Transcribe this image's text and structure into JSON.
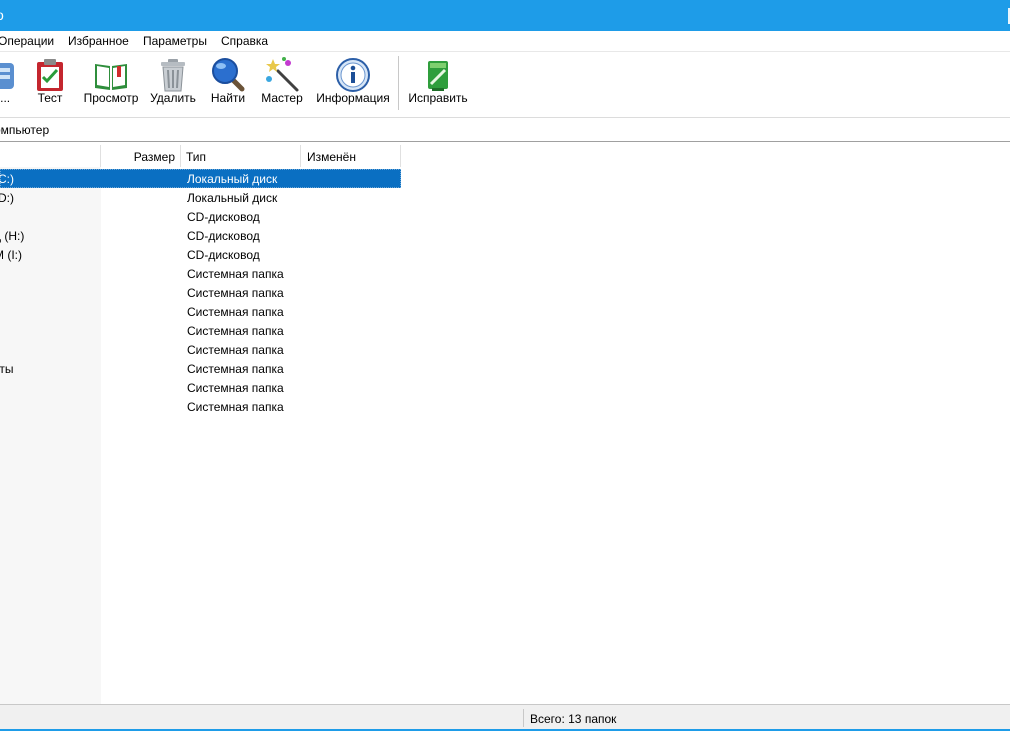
{
  "titlebar": {
    "title_glyph": "о"
  },
  "menu": {
    "items": [
      "Операции",
      "Избранное",
      "Параметры",
      "Справка"
    ]
  },
  "toolbar": {
    "buttons": [
      {
        "label": "ь...",
        "icon": "add-archive-icon"
      },
      {
        "label": "Тест",
        "icon": "test-clipboard-icon"
      },
      {
        "label": "Просмотр",
        "icon": "book-icon"
      },
      {
        "label": "Удалить",
        "icon": "trash-icon"
      },
      {
        "label": "Найти",
        "icon": "magnifier-icon"
      },
      {
        "label": "Мастер",
        "icon": "magic-wand-icon"
      },
      {
        "label": "Информация",
        "icon": "info-icon"
      },
      {
        "label": "Исправить",
        "icon": "repair-icon"
      }
    ]
  },
  "address": {
    "path": "омпьютер"
  },
  "columns": {
    "size": "Размер",
    "type": "Тип",
    "modified": "Изменён"
  },
  "rows": [
    {
      "name": "(C:)",
      "type": "Локальный диск",
      "selected": true
    },
    {
      "name": "(D:)",
      "type": "Локальный диск"
    },
    {
      "name": "",
      "type": "CD-дисковод"
    },
    {
      "name": "д (H:)",
      "type": "CD-дисковод"
    },
    {
      "name": "M (I:)",
      "type": "CD-дисковод"
    },
    {
      "name": "",
      "type": "Системная папка"
    },
    {
      "name": "",
      "type": "Системная папка"
    },
    {
      "name": "",
      "type": "Системная папка"
    },
    {
      "name": "",
      "type": "Системная папка"
    },
    {
      "name": "",
      "type": "Системная папка"
    },
    {
      "name": "кты",
      "type": "Системная папка"
    },
    {
      "name": "",
      "type": "Системная папка"
    },
    {
      "name": "",
      "type": "Системная папка"
    }
  ],
  "status": {
    "total": "Всего: 13 папок"
  },
  "colors": {
    "title_bar": "#1e9ce8",
    "selection": "#0a6fc2",
    "status_bg": "#f0f0f0"
  }
}
